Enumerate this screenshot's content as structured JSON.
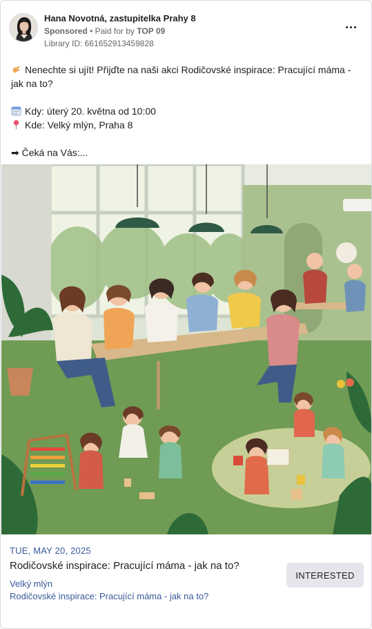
{
  "advertiser": {
    "name": "Hana Novotná, zastupitelka Prahy 8",
    "sponsored_label": "Sponsored",
    "separator": "•",
    "paid_for_prefix": "Paid for by",
    "paid_for_by": "TOP 09",
    "library_id": "Library ID: 661652913459828",
    "avatar_icon": "profile-photo",
    "more_icon": "more-horizontal-icon"
  },
  "post": {
    "line1": "Nenechte si ujít! Přijďte na naši akci Rodičovské inspirace: Pracující máma - jak na to?",
    "when": "Kdy: úterý 20. května od 10:00",
    "where": "Kde: Velký mlýn, Praha 8",
    "teaser": "➡ Čeká na Vás:...",
    "icons": [
      "hand-wave-icon",
      "calendar-icon",
      "pin-icon"
    ]
  },
  "event": {
    "date": "TUE, MAY 20, 2025",
    "title": "Rodičovské inspirace: Pracující máma - jak na to?",
    "place": "Velký mlýn",
    "link": "Rodičovské inspirace: Pracující máma - jak na to?",
    "button": "INTERESTED"
  },
  "colors": {
    "link": "#385898",
    "button_bg": "#e4e6eb",
    "text": "#1c1e21",
    "muted": "#65676b"
  }
}
